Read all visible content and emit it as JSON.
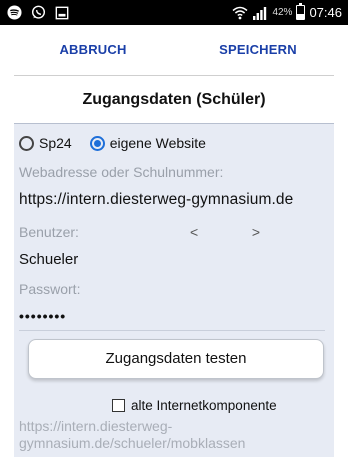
{
  "statusbar": {
    "battery_percent": "42%",
    "battery_level": 0.42,
    "time": "07:46",
    "icons": [
      "spotify-icon",
      "whatsapp-icon",
      "screenshot-icon",
      "wifi-icon",
      "signal-icon",
      "battery-icon"
    ]
  },
  "actionbar": {
    "cancel_label": "ABBRUCH",
    "save_label": "SPEICHERN"
  },
  "page": {
    "title": "Zugangsdaten (Schüler)"
  },
  "form": {
    "radio_options": [
      {
        "label": "Sp24",
        "selected": false
      },
      {
        "label": "eigene Website",
        "selected": true
      }
    ],
    "address_label": "Webadresse oder Schulnummer:",
    "address_value": "https://intern.diesterweg-gymnasium.de",
    "user_label": "Benutzer:",
    "prev_arrow": "<",
    "next_arrow": ">",
    "user_value": "Schueler",
    "password_label": "Passwort:",
    "password_value": "••••••••",
    "test_button_label": "Zugangsdaten testen",
    "checkbox_label": "alte Internetkomponente",
    "checkbox_checked": false,
    "url_hint": "https://intern.diesterweg-gymnasium.de/schueler/mobklassen"
  },
  "colors": {
    "accent": "#1a3fa8",
    "radio_selected": "#1e6fd9",
    "panel_bg": "#e7ebf4"
  }
}
